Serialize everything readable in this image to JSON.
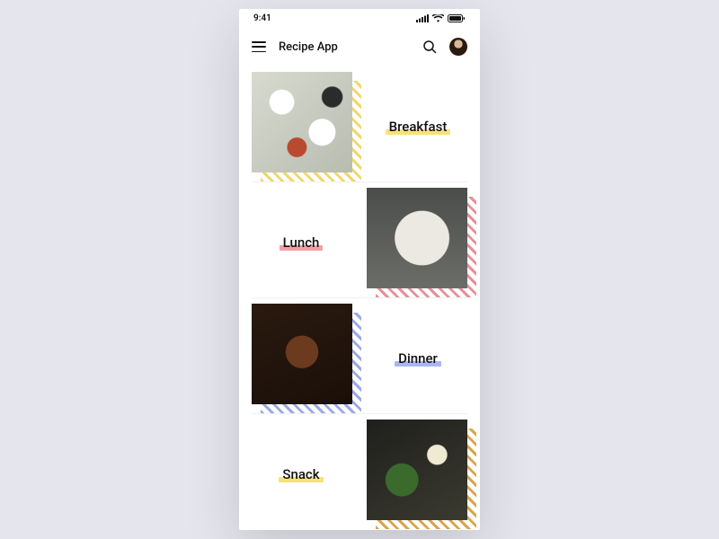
{
  "status": {
    "time": "9:41"
  },
  "header": {
    "title": "Recipe App"
  },
  "categories": [
    {
      "label": "Breakfast",
      "highlight": "#f7e27b",
      "stripe": "#f0d76a"
    },
    {
      "label": "Lunch",
      "highlight": "#f2a0a6",
      "stripe": "#e98f97"
    },
    {
      "label": "Dinner",
      "highlight": "#a9b7ef",
      "stripe": "#9aa9e6"
    },
    {
      "label": "Snack",
      "highlight": "#f7e27b",
      "stripe": "#d9a54a"
    }
  ]
}
